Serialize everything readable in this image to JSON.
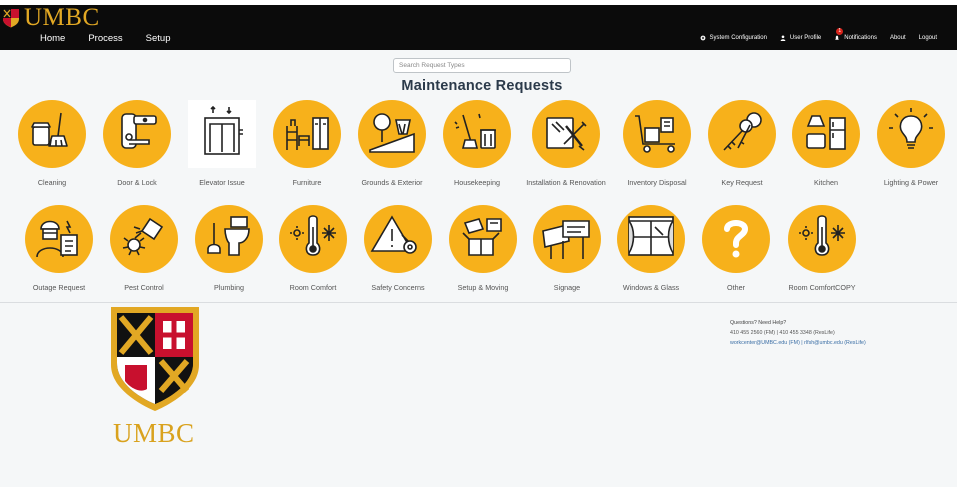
{
  "brand": {
    "name": "UMBC"
  },
  "nav": {
    "left": [
      "Home",
      "Process",
      "Setup"
    ],
    "right": {
      "system": "System Configuration",
      "profile": "User Profile",
      "notifications": "Notifications",
      "about": "About",
      "logout": "Logout",
      "badge": "1"
    }
  },
  "search": {
    "placeholder": "Search Request Types"
  },
  "page": {
    "title": "Maintenance Requests"
  },
  "tiles": [
    {
      "label": "Cleaning",
      "icon": "cleaning-icon"
    },
    {
      "label": "Door & Lock",
      "icon": "door-lock-icon"
    },
    {
      "label": "Elevator Issue",
      "icon": "elevator-icon"
    },
    {
      "label": "Furniture",
      "icon": "furniture-icon"
    },
    {
      "label": "Grounds & Exterior",
      "icon": "grounds-icon"
    },
    {
      "label": "Housekeeping",
      "icon": "housekeeping-icon"
    },
    {
      "label": "Installation & Renovation",
      "icon": "installation-icon"
    },
    {
      "label": "Inventory Disposal",
      "icon": "inventory-cart-icon"
    },
    {
      "label": "Key Request",
      "icon": "keys-icon"
    },
    {
      "label": "Kitchen",
      "icon": "kitchen-icon"
    },
    {
      "label": "Lighting & Power",
      "icon": "lightbulb-icon"
    },
    {
      "label": "Outage Request",
      "icon": "outage-worker-icon"
    },
    {
      "label": "Pest Control",
      "icon": "pest-spray-icon"
    },
    {
      "label": "Plumbing",
      "icon": "toilet-plunger-icon"
    },
    {
      "label": "Room Comfort",
      "icon": "thermometer-icon"
    },
    {
      "label": "Safety Concerns",
      "icon": "safety-warning-icon"
    },
    {
      "label": "Setup & Moving",
      "icon": "moving-boxes-icon"
    },
    {
      "label": "Signage",
      "icon": "signage-icon"
    },
    {
      "label": "Windows & Glass",
      "icon": "window-icon"
    },
    {
      "label": "Other",
      "icon": "question-icon"
    },
    {
      "label": "Room ComfortCOPY",
      "icon": "thermometer-icon"
    }
  ],
  "footer": {
    "wordmark": "UMBC",
    "help_title": "Questions? Need Help?",
    "phones": "410 455 2560 (FM) | 410 455 3348 (ResLife)",
    "emails": "workcenter@UMBC.edu (FM) | rlfsh@umbc.edu (ResLife)"
  },
  "colors": {
    "navbar": "#0b0b0b",
    "accent": "#f7b11b",
    "brand_gold": "#e2a824",
    "title": "#2b3a4a"
  }
}
